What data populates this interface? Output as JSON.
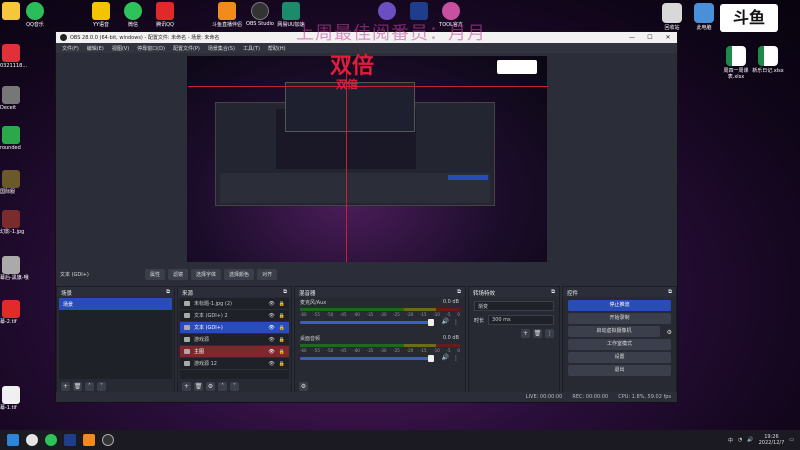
{
  "overlay": {
    "top_text": "上周最佳阅番员：月月",
    "big_text": "双倍",
    "small_text": "双倍"
  },
  "desktop": {
    "top_icons": [
      {
        "label": "QQ面对",
        "icon": "qq-browser-icon",
        "color": "#f5c73a"
      },
      {
        "label": "QQ音乐",
        "icon": "qq-music-icon",
        "color": "#2bbd5a"
      },
      {
        "label": "YY语音",
        "icon": "yy-icon",
        "color": "#f4c400"
      },
      {
        "label": "微信",
        "icon": "wechat-icon",
        "color": "#2dc35a"
      },
      {
        "label": "腾讯QQ",
        "icon": "qq-icon",
        "color": "#e02a2a"
      },
      {
        "label": "斗鱼直播伴侣",
        "icon": "douyu-icon",
        "color": "#f28a1c"
      },
      {
        "label": "OBS Studio",
        "icon": "obs-icon",
        "color": "#333333"
      },
      {
        "label": "网易UU加速",
        "icon": "uu-icon",
        "color": "#1b8c6b"
      },
      {
        "label": "",
        "icon": "app-icon",
        "color": "#6b4fc2"
      },
      {
        "label": "",
        "icon": "photoshop-icon",
        "color": "#1f3d8a"
      },
      {
        "label": "TOOL官方",
        "icon": "tool-icon",
        "color": "#c850a0"
      }
    ],
    "right_icons": [
      {
        "label": "回收站",
        "icon": "recycle-bin-icon",
        "color": "#d8d8d8"
      },
      {
        "label": "此电脑",
        "icon": "computer-icon",
        "color": "#4a90d8"
      },
      {
        "label": "周四一周课表.xlsx",
        "icon": "excel-icon",
        "color": "#1e8a4a"
      },
      {
        "label": "新乐日记.xlsx",
        "icon": "excel-icon",
        "color": "#1e8a4a"
      }
    ],
    "left_icons": [
      {
        "label": "0321118...",
        "icon": "netease-icon",
        "color": "#e0303a"
      },
      {
        "label": "",
        "icon": "app-icon",
        "color": "#c02f2f"
      },
      {
        "label": "Deceit",
        "icon": "deceit-icon",
        "color": "#888888"
      },
      {
        "label": "rounded",
        "icon": "game-icon",
        "color": "#2aa84a"
      },
      {
        "label": "国际服",
        "icon": "game2-icon",
        "color": "#6a5a2a"
      },
      {
        "label": "幻影-1.jpg",
        "icon": "image-icon",
        "color": "#7a2b2b"
      },
      {
        "label": "幕后-黑旗-哦",
        "icon": "game3-icon",
        "color": "#aaaaaa"
      },
      {
        "label": "幕-2.tif",
        "icon": "image2-icon",
        "color": "#e22a2a"
      },
      {
        "label": "幕-1.tif",
        "icon": "image3-icon",
        "color": "#f0f0f0"
      }
    ]
  },
  "obs": {
    "title": "OBS 28.0.0 (64-bit, windows) - 配置文件: 未命名 - 场景: 未命名",
    "menu": [
      "文件(F)",
      "编辑(E)",
      "视图(V)",
      "停靠窗口(D)",
      "配置文件(P)",
      "场景集合(S)",
      "工具(T)",
      "帮助(H)"
    ],
    "context": {
      "source": "文本 (GDI+)",
      "buttons": [
        "属性",
        "滤镜",
        "选择字体",
        "选择颜色",
        "对齐"
      ]
    },
    "scenes": {
      "title": "场景",
      "items": [
        "场景"
      ]
    },
    "sources": {
      "title": "来源",
      "items": [
        {
          "name": "未标题-1.jpg (2)",
          "state": "normal"
        },
        {
          "name": "文本 (GDI+) 2",
          "state": "normal"
        },
        {
          "name": "文本 (GDI+)",
          "state": "selected"
        },
        {
          "name": "游戏源",
          "state": "normal"
        },
        {
          "name": "主图",
          "state": "red"
        },
        {
          "name": "游戏源 12",
          "state": "normal"
        }
      ]
    },
    "mixer": {
      "title": "混音器",
      "tracks": [
        {
          "name": "麦克风/Aux",
          "db": "0.0 dB"
        },
        {
          "name": "桌面音频",
          "db": "0.0 dB"
        }
      ],
      "scale": [
        "-60",
        "-55",
        "-50",
        "-45",
        "-40",
        "-35",
        "-30",
        "-25",
        "-20",
        "-15",
        "-10",
        "-5",
        "0"
      ]
    },
    "transitions": {
      "title": "转场特效",
      "type": "渐变",
      "duration_label": "时长",
      "duration": "300 ms"
    },
    "controls": {
      "title": "控件",
      "buttons": [
        "停止推流",
        "开始录制",
        "启动虚拟摄像机",
        "工作室模式",
        "设置",
        "退出"
      ]
    },
    "status": {
      "live": "LIVE: 00:00:00",
      "rec": "REC: 00:00:00",
      "cpu": "CPU: 1.8%, 59.02 fps"
    }
  },
  "taskbar": {
    "tray_text": "中",
    "time": "19:26",
    "date": "2022/12/7"
  }
}
